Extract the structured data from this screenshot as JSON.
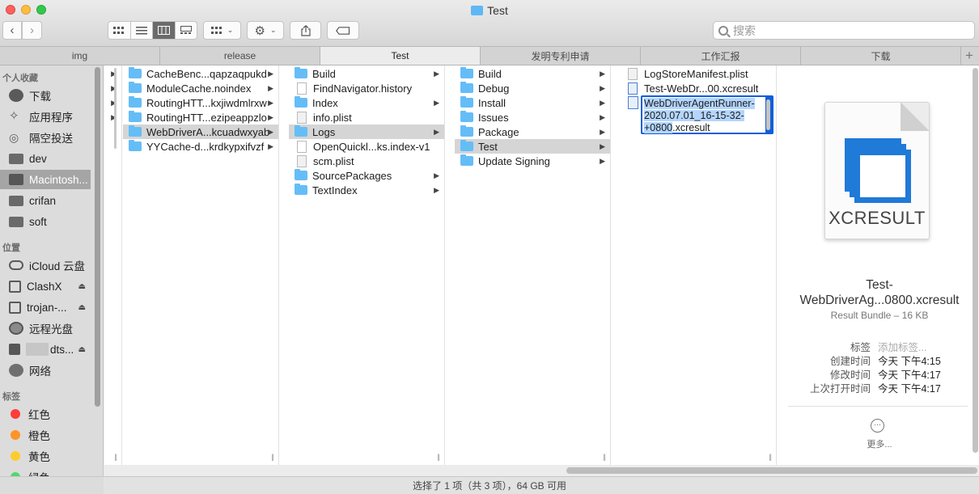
{
  "window": {
    "title": "Test"
  },
  "toolbar": {
    "search_placeholder": "搜索"
  },
  "tabs": [
    "img",
    "release",
    "Test",
    "发明专利申请",
    "工作汇报",
    "下载"
  ],
  "sidebar": {
    "favorites_header": "个人收藏",
    "favorites": [
      "下载",
      "应用程序",
      "隔空投送",
      "dev",
      "Macintosh...",
      "crifan",
      "soft"
    ],
    "locations_header": "位置",
    "locations": [
      "iCloud 云盘",
      "ClashX",
      "trojan-...",
      "远程光盘",
      "dts...",
      "网络"
    ],
    "tags_header": "标签",
    "tags": [
      {
        "label": "红色",
        "color": "#fc3d39"
      },
      {
        "label": "橙色",
        "color": "#fd9426"
      },
      {
        "label": "黄色",
        "color": "#fecb2f"
      },
      {
        "label": "绿色",
        "color": "#53d769"
      }
    ]
  },
  "columns": {
    "col1": [
      "CacheBenc...qapzaqpukd",
      "ModuleCache.noindex",
      "RoutingHTT...kxjiwdmlrxw",
      "RoutingHTT...ezipeappzlo",
      "WebDriverA...kcuadwxyab",
      "YYCache-d...krdkypxifvzf"
    ],
    "col2": [
      "Build",
      "FindNavigator.history",
      "Index",
      "info.plist",
      "Logs",
      "OpenQuickl...ks.index-v1",
      "scm.plist",
      "SourcePackages",
      "TextIndex"
    ],
    "col3": [
      "Build",
      "Debug",
      "Install",
      "Issues",
      "Package",
      "Test",
      "Update Signing"
    ],
    "col4": [
      "LogStoreManifest.plist",
      "Test-WebDr...00.xcresult"
    ],
    "selected_name_part1": "WebDriverAgentRunner-2020.07.01_16-15-32-+0800",
    "selected_name_part2": ".xcresult"
  },
  "preview": {
    "icon_label": "XCRESULT",
    "name": "Test-WebDriverAg...0800.xcresult",
    "kind": "Result Bundle – 16 KB",
    "meta": [
      {
        "key": "标签",
        "value": "添加标签..."
      },
      {
        "key": "创建时间",
        "value": "今天 下午4:15"
      },
      {
        "key": "修改时间",
        "value": "今天 下午4:17"
      },
      {
        "key": "上次打开时间",
        "value": "今天 下午4:17"
      }
    ],
    "more_label": "更多..."
  },
  "status": {
    "text": "选择了 1 项（共 3 项），64 GB 可用"
  }
}
